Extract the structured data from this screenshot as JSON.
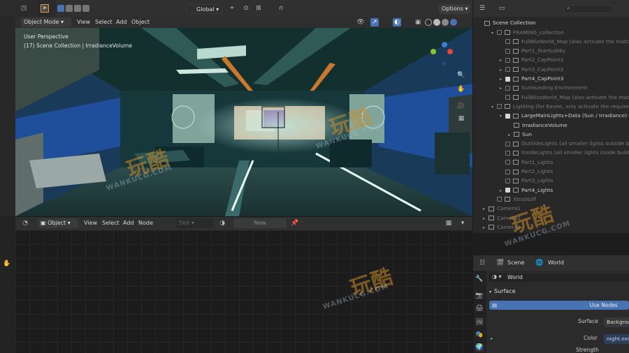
{
  "viewport": {
    "mode": "Object Mode",
    "menus": [
      "View",
      "Select",
      "Add",
      "Object"
    ],
    "transform": "Global",
    "options": "Options",
    "info_line1": "User Perspective",
    "info_line2": "(17) Scene Collection | IrradianceVolume"
  },
  "node_editor": {
    "mode": "Object",
    "menus": [
      "View",
      "Select",
      "Add",
      "Node"
    ],
    "slot": "Slot",
    "new_label": "New"
  },
  "outliner": {
    "title": "Scene Collection",
    "rows": [
      {
        "indent": 1,
        "tri": "▾",
        "check": false,
        "label": "FRAMING_collection",
        "dim": true
      },
      {
        "indent": 2,
        "tri": "",
        "check": false,
        "label": "FullBlizWorld_Map (also activate the matching",
        "dim": true
      },
      {
        "indent": 2,
        "tri": "",
        "check": false,
        "label": "Part1_StartLobby",
        "dim": true
      },
      {
        "indent": 2,
        "tri": "▸",
        "check": false,
        "label": "Part2_CapPoint1",
        "dim": true
      },
      {
        "indent": 2,
        "tri": "▸",
        "check": false,
        "label": "Part3_CapPoint2",
        "dim": true
      },
      {
        "indent": 2,
        "tri": "▸",
        "check": true,
        "label": "Part4_CapPoint3",
        "dim": false
      },
      {
        "indent": 2,
        "tri": "▸",
        "check": false,
        "label": "Surrounding Environment",
        "dim": true
      },
      {
        "indent": 2,
        "tri": "",
        "check": false,
        "label": "FullBlizzWorld_Map (also activate the matching",
        "dim": true
      },
      {
        "indent": 1,
        "tri": "▾",
        "check": false,
        "label": "Lighting (for Eevee, only activate the required li",
        "dim": true
      },
      {
        "indent": 2,
        "tri": "▾",
        "check": true,
        "label": "LargeMainLights+Data (Sun / Irradiance)",
        "dim": false
      },
      {
        "indent": 3,
        "tri": "",
        "check": null,
        "label": "IrradianceVolume",
        "dim": false
      },
      {
        "indent": 3,
        "tri": "▸",
        "check": null,
        "label": "Sun",
        "dim": false
      },
      {
        "indent": 2,
        "tri": "",
        "check": false,
        "label": "OutSideLights (all smaller lights outside buil",
        "dim": true
      },
      {
        "indent": 2,
        "tri": "",
        "check": false,
        "label": "InsideLights (all smaller lights inside buildi",
        "dim": true
      },
      {
        "indent": 2,
        "tri": "",
        "check": false,
        "label": "Part1_Lights",
        "dim": true
      },
      {
        "indent": 2,
        "tri": "",
        "check": false,
        "label": "Part2_Lights",
        "dim": true
      },
      {
        "indent": 2,
        "tri": "",
        "check": false,
        "label": "Part3_Lights",
        "dim": true
      },
      {
        "indent": 2,
        "tri": "▸",
        "check": true,
        "label": "Part4_Lights",
        "dim": false
      },
      {
        "indent": 1,
        "tri": "",
        "check": false,
        "label": "XtraStuff",
        "dim": true
      },
      {
        "indent": 0,
        "tri": "▸",
        "check": null,
        "label": "Camera1",
        "dim": true
      },
      {
        "indent": 0,
        "tri": "▸",
        "check": null,
        "label": "Camera2",
        "dim": true
      },
      {
        "indent": 0,
        "tri": "▸",
        "check": null,
        "label": "Camera3",
        "dim": true
      }
    ]
  },
  "properties": {
    "tab_scene": "Scene",
    "tab_world": "World",
    "world_name": "World",
    "section": "Surface",
    "use_nodes": "Use Nodes",
    "surface_label": "Surface",
    "surface_value": "Backgrou",
    "color_label": "Color",
    "color_value": "night.exr",
    "strength_label": "Strength"
  },
  "watermark": {
    "text1": "玩酷",
    "text2": "WANKUCG.COM"
  },
  "colors": {
    "accent_blue": "#4772b3",
    "header": "#303030",
    "panel": "#282828"
  }
}
